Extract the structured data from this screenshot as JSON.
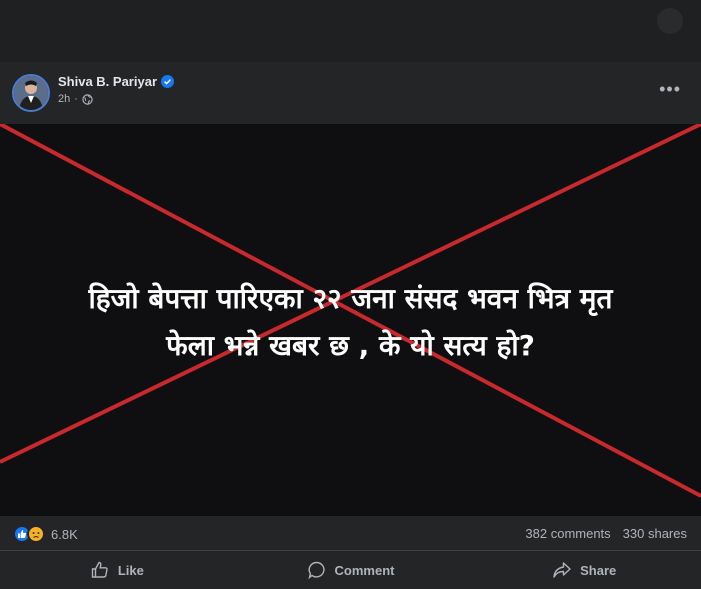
{
  "post": {
    "author": "Shiva B. Pariyar",
    "time": "2h",
    "separator": "·",
    "more_label": "•••",
    "image_text": {
      "line1": "हिजो बेपत्ता पारिएका २२ जना संसद भवन भित्र मृत",
      "line2": "फेला भन्ने खबर छ , के यो सत्य हो?"
    },
    "reaction_count": "6.8K",
    "comments": "382 comments",
    "shares": "330 shares",
    "actions": {
      "like": "Like",
      "comment": "Comment",
      "share": "Share"
    }
  },
  "colors": {
    "background": "#1c1d1f",
    "card": "#242526",
    "image_bg": "#0f0f11",
    "cross": "#c8292c",
    "like_blue": "#1877f2",
    "sad_yellow": "#f7b125",
    "text_secondary": "#b0b3b8"
  },
  "icons": [
    "verified-badge-icon",
    "globe-icon",
    "more-options-icon",
    "like-reaction-icon",
    "sad-reaction-icon",
    "thumbs-up-icon",
    "comment-icon",
    "share-icon"
  ]
}
